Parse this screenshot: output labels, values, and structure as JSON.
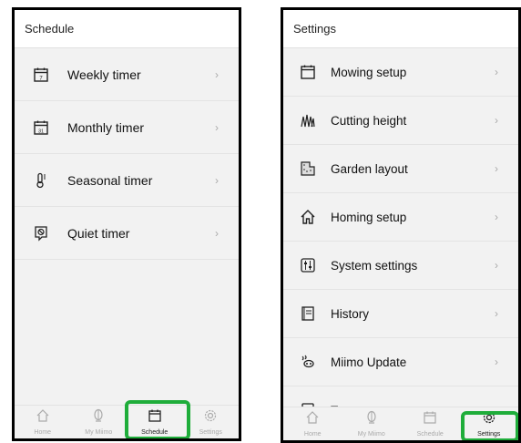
{
  "left": {
    "header_title": "Schedule",
    "items": [
      {
        "label": "Weekly timer",
        "icon": "weekly-calendar-icon"
      },
      {
        "label": "Monthly timer",
        "icon": "monthly-calendar-icon"
      },
      {
        "label": "Seasonal timer",
        "icon": "thermometer-icon"
      },
      {
        "label": "Quiet timer",
        "icon": "quiet-icon"
      }
    ],
    "nav": [
      {
        "label": "Home",
        "icon": "home-icon"
      },
      {
        "label": "My Miimo",
        "icon": "mower-icon"
      },
      {
        "label": "Schedule",
        "icon": "calendar-icon",
        "active": true
      },
      {
        "label": "Settings",
        "icon": "gear-icon"
      }
    ]
  },
  "right": {
    "header_title": "Settings",
    "items": [
      {
        "label": "Mowing setup",
        "icon": "calendar-icon"
      },
      {
        "label": "Cutting height",
        "icon": "grass-icon"
      },
      {
        "label": "Garden layout",
        "icon": "garden-map-icon"
      },
      {
        "label": "Homing setup",
        "icon": "home-icon"
      },
      {
        "label": "System settings",
        "icon": "sliders-icon"
      },
      {
        "label": "History",
        "icon": "book-icon"
      },
      {
        "label": "Miimo Update",
        "icon": "update-icon"
      },
      {
        "label": "Test",
        "icon": "checklist-icon"
      }
    ],
    "nav": [
      {
        "label": "Home",
        "icon": "home-icon"
      },
      {
        "label": "My Miimo",
        "icon": "mower-icon"
      },
      {
        "label": "Schedule",
        "icon": "calendar-icon"
      },
      {
        "label": "Settings",
        "icon": "gear-icon",
        "active": true
      }
    ]
  },
  "colors": {
    "highlight": "#1fad3a",
    "background": "#f2f2f2"
  }
}
